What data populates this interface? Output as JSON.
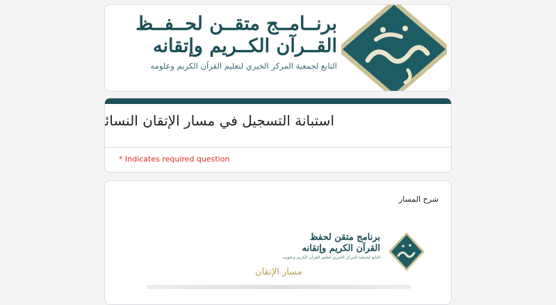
{
  "banner": {
    "line1": "برنــامــج متقــن لحــفــظ",
    "line2": "القــرآن الكــريم وإتقانه",
    "line3": "التابع لجمعية المركز الخيري لتعليم القرآن الكريم وعلومه",
    "logo_text": "متقن",
    "logo_color": "#1d5c63"
  },
  "form": {
    "title": "استبانة التسجيل في مسار الإتقان النسائي",
    "required_note": "* Indicates required question",
    "accent_color": "#1d4f56"
  },
  "section": {
    "label": "شرح المسار",
    "track_name": "مسار الإتقان"
  },
  "mini_banner": {
    "line1": "برنامج متقن لحفظ",
    "line2": "القرآن الكريم وإتقانه",
    "line3": "التابع لجمعية المركز الخيري لتعليم القرآن الكريم وعلومه"
  }
}
